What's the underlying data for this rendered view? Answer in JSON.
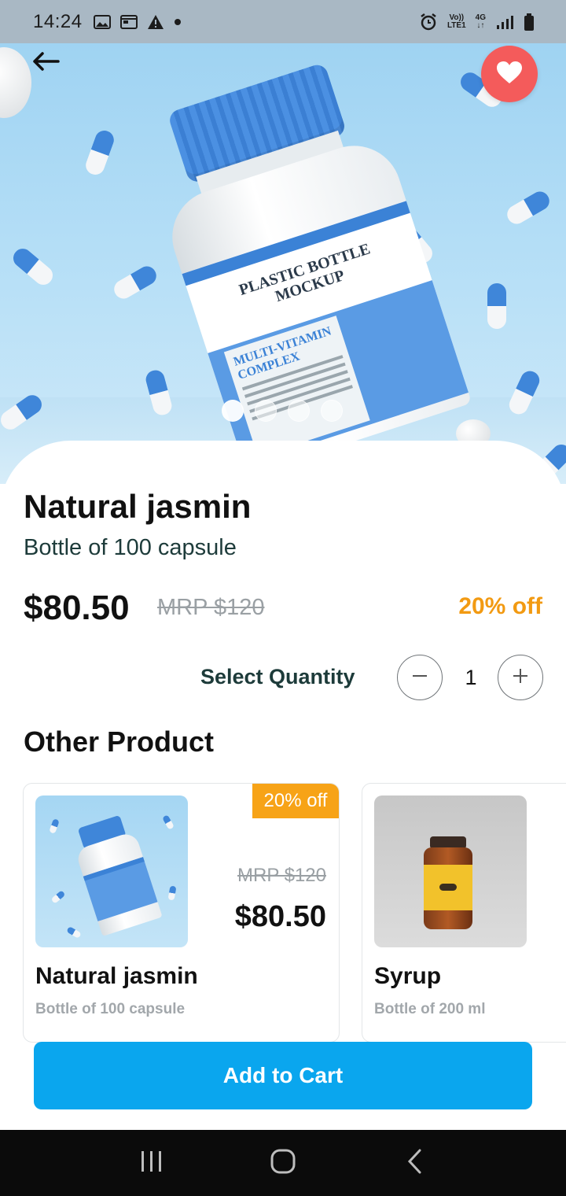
{
  "status_bar": {
    "time": "14:24",
    "volte_label": "Vo))",
    "lte_label": "LTE1",
    "net_label": "4G",
    "icons": [
      "image-icon",
      "calendar-icon",
      "alert-icon",
      "dot-icon",
      "alarm-icon",
      "signal-icon",
      "battery-icon"
    ]
  },
  "hero": {
    "bottle_label_title": "PLASTIC BOTTLE MOCKUP",
    "bottle_label_sub": "MULTI-VITAMIN COMPLEX",
    "dots_count": 4,
    "active_dot": 0,
    "favorite_color": "#f45b5b"
  },
  "product": {
    "title": "Natural jasmin",
    "subtitle": "Bottle of 100 capsule",
    "price": "$80.50",
    "mrp": "MRP $120",
    "discount": "20% off"
  },
  "quantity": {
    "label": "Select Quantity",
    "value": "1"
  },
  "other_products": {
    "title": "Other Product",
    "items": [
      {
        "badge": "20% off",
        "mrp": "MRP $120",
        "price": "$80.50",
        "name": "Natural jasmin",
        "sub": "Bottle of 100 capsule"
      },
      {
        "name": "Syrup",
        "sub": "Bottle of 200 ml"
      }
    ]
  },
  "cart_button": "Add to Cart",
  "colors": {
    "accent": "#0aa6ee",
    "discount": "#f29a12",
    "badge": "#f7a317",
    "favorite": "#f45b5b"
  }
}
